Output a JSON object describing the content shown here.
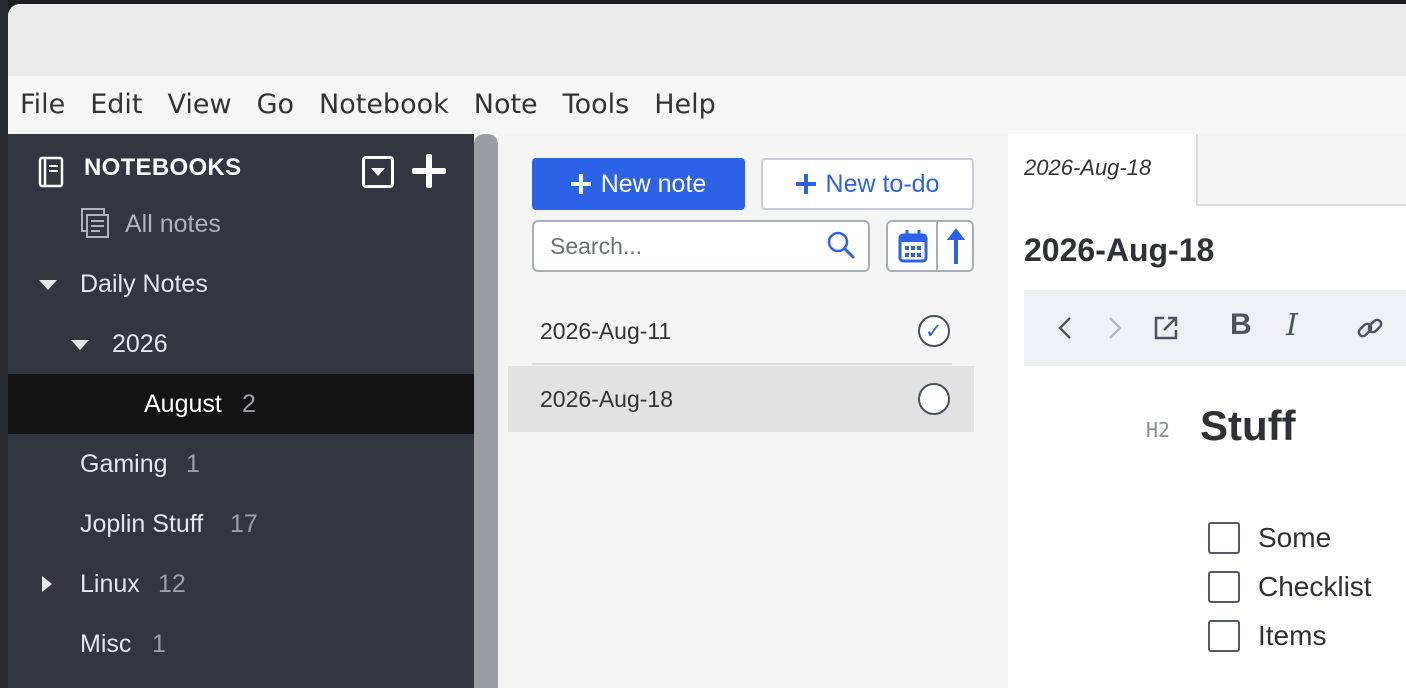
{
  "menubar": [
    "File",
    "Edit",
    "View",
    "Go",
    "Notebook",
    "Note",
    "Tools",
    "Help"
  ],
  "sidebar": {
    "title": "NOTEBOOKS",
    "all_notes": "All notes",
    "items": [
      {
        "label": "Daily Notes",
        "count": ""
      },
      {
        "label": "2026",
        "count": ""
      },
      {
        "label": "August",
        "count": "2"
      },
      {
        "label": "Gaming",
        "count": "1"
      },
      {
        "label": "Joplin Stuff",
        "count": "17"
      },
      {
        "label": "Linux",
        "count": "12"
      },
      {
        "label": "Misc",
        "count": "1"
      }
    ]
  },
  "notelist": {
    "new_note": "New note",
    "new_todo": "New to-do",
    "search_placeholder": "Search...",
    "notes": [
      {
        "title": "2026-Aug-11",
        "completed": true
      },
      {
        "title": "2026-Aug-18",
        "completed": false
      }
    ]
  },
  "editor": {
    "tab": "2026-Aug-18",
    "title": "2026-Aug-18",
    "heading_tag": "H2",
    "heading": "Stuff",
    "checklist": [
      "Some",
      "Checklist",
      "Items"
    ],
    "toolbar": {
      "bold": "B",
      "italic": "I"
    }
  },
  "colors": {
    "sidebar_bg": "#313640",
    "selected_bg": "#131313",
    "accent": "#2b62e8"
  }
}
